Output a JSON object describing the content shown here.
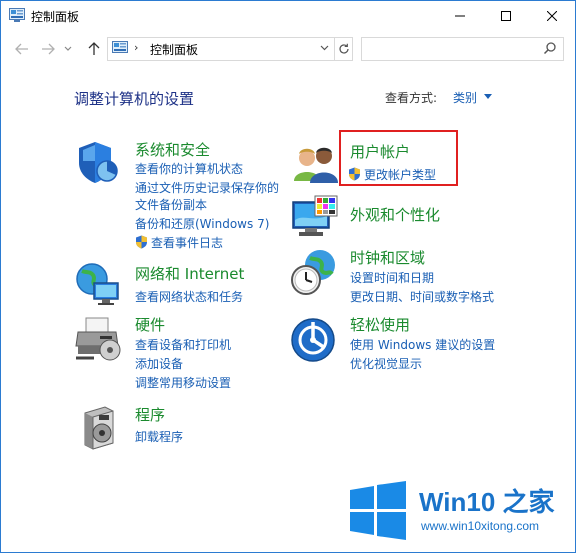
{
  "window": {
    "title": "控制面板",
    "controls": {
      "minimize": "minimize",
      "maximize": "maximize",
      "close": "close"
    }
  },
  "address": {
    "path": "控制面板",
    "separator": "›",
    "search_placeholder": ""
  },
  "main": {
    "heading": "调整计算机的设置",
    "view_by_label": "查看方式:",
    "view_by_value": "类别"
  },
  "categories": {
    "system": {
      "title": "系统和安全",
      "links": [
        "查看你的计算机状态",
        "通过文件历史记录保存你的",
        "文件备份副本",
        "备份和还原(Windows 7)",
        "查看事件日志"
      ]
    },
    "network": {
      "title": "网络和 Internet",
      "links": [
        "查看网络状态和任务"
      ]
    },
    "hardware": {
      "title": "硬件",
      "links": [
        "查看设备和打印机",
        "添加设备",
        "调整常用移动设置"
      ]
    },
    "programs": {
      "title": "程序",
      "links": [
        "卸载程序"
      ]
    },
    "users": {
      "title": "用户帐户",
      "links": [
        "更改帐户类型"
      ]
    },
    "appearance": {
      "title": "外观和个性化",
      "links": []
    },
    "clock": {
      "title": "时钟和区域",
      "links": [
        "设置时间和日期",
        "更改日期、时间或数字格式"
      ]
    },
    "ease": {
      "title": "轻松使用",
      "links": [
        "使用 Windows 建议的设置",
        "优化视觉显示"
      ]
    }
  },
  "watermark": {
    "title": "Win10 之家",
    "url": "www.win10xitong.com"
  },
  "colors": {
    "accent": "#1a5fb4",
    "category_title": "#1a8a2e",
    "heading": "#1e3287",
    "highlight": "#e02020",
    "watermark": "#1a73c9"
  }
}
